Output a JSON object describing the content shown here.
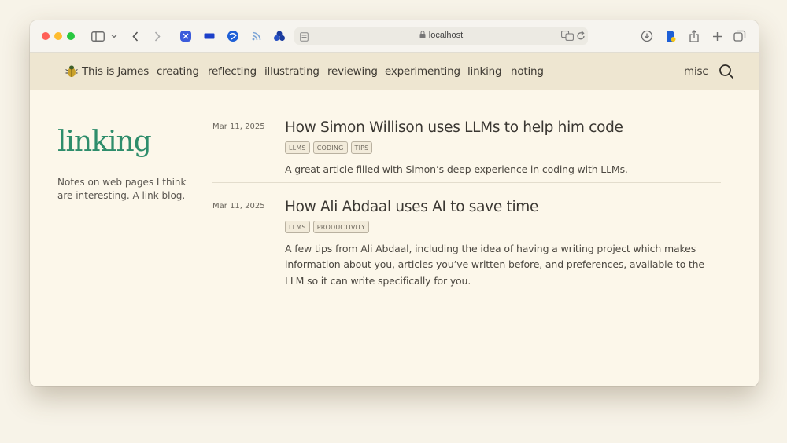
{
  "browser": {
    "url": "localhost"
  },
  "site": {
    "brand": "This is James",
    "nav": [
      "creating",
      "reflecting",
      "illustrating",
      "reviewing",
      "experimenting",
      "linking",
      "noting"
    ],
    "misc": "misc"
  },
  "page": {
    "heading": "linking",
    "description": "Notes on web pages I think are interesting. A link blog."
  },
  "posts": [
    {
      "date": "Mar 11, 2025",
      "title": "How Simon Willison uses LLMs to help him code",
      "tags": [
        "LLMS",
        "CODING",
        "TIPS"
      ],
      "summary": "A great article filled with Simon’s deep experience in coding with LLMs."
    },
    {
      "date": "Mar 11, 2025",
      "title": "How Ali Abdaal uses AI to save time",
      "tags": [
        "LLMS",
        "PRODUCTIVITY"
      ],
      "summary": "A few tips from Ali Abdaal, including the idea of having a writing project which makes information about you, articles you’ve written before, and preferences, available to the LLM so it can write specifically for you."
    }
  ],
  "colors": {
    "accent": "#2e8d6b",
    "header_bg": "#eee6d1",
    "page_bg": "#fcf7ea"
  }
}
